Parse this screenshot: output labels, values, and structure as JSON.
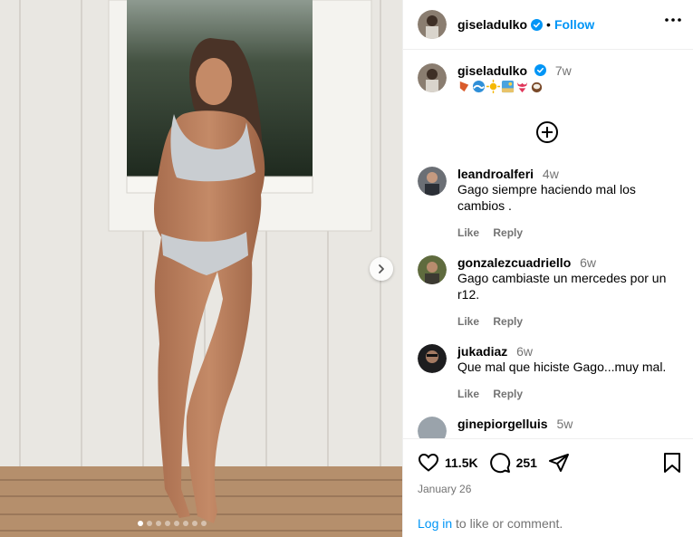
{
  "header": {
    "username": "giseladulko",
    "separator": "•",
    "follow_label": "Follow"
  },
  "caption": {
    "username": "giseladulko",
    "time": "7w",
    "emojis": [
      "flag-icon",
      "wave-icon",
      "sun-icon",
      "beach-icon",
      "bikini-icon",
      "coconut-icon"
    ]
  },
  "comments": [
    {
      "username": "leandroalferi",
      "time": "4w",
      "text": "Gago siempre haciendo mal los cambios .",
      "like": "Like",
      "reply": "Reply"
    },
    {
      "username": "gonzalezcuadriello",
      "time": "6w",
      "text": "Gago cambiaste un mercedes por un r12.",
      "like": "Like",
      "reply": "Reply"
    },
    {
      "username": "jukadiaz",
      "time": "6w",
      "text": "Que mal que hiciste Gago...muy mal.",
      "like": "Like",
      "reply": "Reply"
    },
    {
      "username": "ginepiorgelluis",
      "time": "5w",
      "text": "",
      "like": "",
      "reply": ""
    }
  ],
  "actions": {
    "likes": "11.5K",
    "comments": "251",
    "date": "January 26"
  },
  "footer": {
    "login_link": "Log in",
    "login_rest": " to like or comment."
  },
  "carousel": {
    "total": 8,
    "current": 1
  },
  "colors": {
    "accent": "#0095f6",
    "verified": "#0095f6",
    "muted": "#737373",
    "divider": "#efefef"
  }
}
